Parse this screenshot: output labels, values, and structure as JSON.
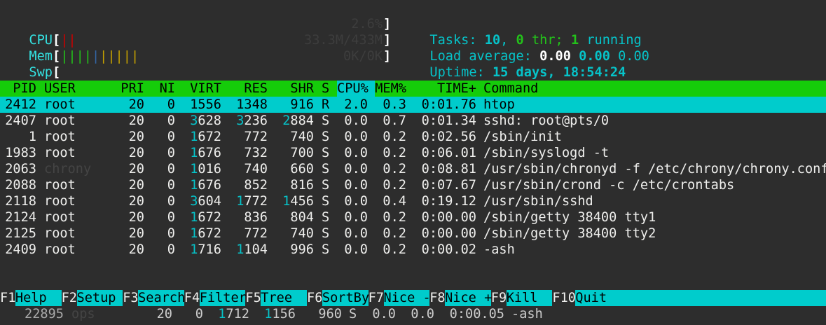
{
  "meters": {
    "cpu": {
      "label": "CPU",
      "bars": "||",
      "value": "2.6%"
    },
    "mem": {
      "label": "Mem",
      "bars_green": "||||",
      "bars_blue": "|",
      "bars_yellow": "|||||",
      "value": "33.3M/433M"
    },
    "swp": {
      "label": "Swp",
      "value": "0K/0K"
    }
  },
  "stats": {
    "tasks_label": "Tasks:",
    "tasks_count": "10",
    "thr_count": "0",
    "thr_label": "thr;",
    "running_count": "1",
    "running_label": "running",
    "load_label": "Load average:",
    "load1": "0.00",
    "load5": "0.00",
    "load15": "0.00",
    "uptime_label": "Uptime:",
    "uptime_value": "15 days, 18:54:24"
  },
  "columns": [
    "PID",
    "USER",
    "PRI",
    "NI",
    "VIRT",
    "RES",
    "SHR",
    "S",
    "CPU%",
    "MEM%",
    "TIME+",
    "Command"
  ],
  "processes": [
    {
      "pid": "2412",
      "user": "root",
      "pri": "20",
      "ni": "0",
      "virt": "1556",
      "res": "1348",
      "shr": "916",
      "s": "R",
      "cpu": "2.0",
      "mem": "0.3",
      "time": "0:01.76",
      "cmd": "htop"
    },
    {
      "pid": "2407",
      "user": "root",
      "pri": "20",
      "ni": "0",
      "virt": "3628",
      "res": "3236",
      "shr": "2884",
      "s": "S",
      "cpu": "0.0",
      "mem": "0.7",
      "time": "0:01.34",
      "cmd": "sshd: root@pts/0"
    },
    {
      "pid": "1",
      "user": "root",
      "pri": "20",
      "ni": "0",
      "virt": "1672",
      "res": "772",
      "shr": "740",
      "s": "S",
      "cpu": "0.0",
      "mem": "0.2",
      "time": "0:02.56",
      "cmd": "/sbin/init"
    },
    {
      "pid": "1983",
      "user": "root",
      "pri": "20",
      "ni": "0",
      "virt": "1676",
      "res": "732",
      "shr": "700",
      "s": "S",
      "cpu": "0.0",
      "mem": "0.2",
      "time": "0:06.01",
      "cmd": "/sbin/syslogd -t"
    },
    {
      "pid": "2063",
      "user": "chrony",
      "pri": "20",
      "ni": "0",
      "virt": "1016",
      "res": "740",
      "shr": "660",
      "s": "S",
      "cpu": "0.0",
      "mem": "0.2",
      "time": "0:08.81",
      "cmd": "/usr/sbin/chronyd -f /etc/chrony/chrony.conf"
    },
    {
      "pid": "2088",
      "user": "root",
      "pri": "20",
      "ni": "0",
      "virt": "1676",
      "res": "852",
      "shr": "816",
      "s": "S",
      "cpu": "0.0",
      "mem": "0.2",
      "time": "0:07.67",
      "cmd": "/usr/sbin/crond -c /etc/crontabs"
    },
    {
      "pid": "2118",
      "user": "root",
      "pri": "20",
      "ni": "0",
      "virt": "3604",
      "res": "1772",
      "shr": "1456",
      "s": "S",
      "cpu": "0.0",
      "mem": "0.4",
      "time": "0:19.12",
      "cmd": "/usr/sbin/sshd"
    },
    {
      "pid": "2124",
      "user": "root",
      "pri": "20",
      "ni": "0",
      "virt": "1672",
      "res": "836",
      "shr": "804",
      "s": "S",
      "cpu": "0.0",
      "mem": "0.2",
      "time": "0:00.00",
      "cmd": "/sbin/getty 38400 tty1"
    },
    {
      "pid": "2125",
      "user": "root",
      "pri": "20",
      "ni": "0",
      "virt": "1672",
      "res": "772",
      "shr": "740",
      "s": "S",
      "cpu": "0.0",
      "mem": "0.2",
      "time": "0:00.00",
      "cmd": "/sbin/getty 38400 tty2"
    },
    {
      "pid": "2409",
      "user": "root",
      "pri": "20",
      "ni": "0",
      "virt": "1716",
      "res": "1104",
      "shr": "996",
      "s": "S",
      "cpu": "0.0",
      "mem": "0.2",
      "time": "0:00.02",
      "cmd": "-ash"
    }
  ],
  "function_keys": [
    {
      "key": "F1",
      "label": "Help  "
    },
    {
      "key": "F2",
      "label": "Setup "
    },
    {
      "key": "F3",
      "label": "Search"
    },
    {
      "key": "F4",
      "label": "Filter"
    },
    {
      "key": "F5",
      "label": "Tree  "
    },
    {
      "key": "F6",
      "label": "SortBy"
    },
    {
      "key": "F7",
      "label": "Nice -"
    },
    {
      "key": "F8",
      "label": "Nice +"
    },
    {
      "key": "F9",
      "label": "Kill  "
    },
    {
      "key": "F10",
      "label": "Quit  "
    }
  ],
  "background_row": {
    "pid": "22895",
    "user": "ops",
    "pri": "20",
    "ni": "0",
    "virt": "1712",
    "res": "1156",
    "shr": "960",
    "s": "S",
    "cpu": "0.0",
    "mem": "0.0",
    "time": "0:00.05",
    "cmd": "-ash"
  },
  "colors": {
    "header_bg": "#15cc0a",
    "selected_bg": "#00cccc",
    "cyan": "#34e2e2",
    "background": "#2d2d2d"
  }
}
